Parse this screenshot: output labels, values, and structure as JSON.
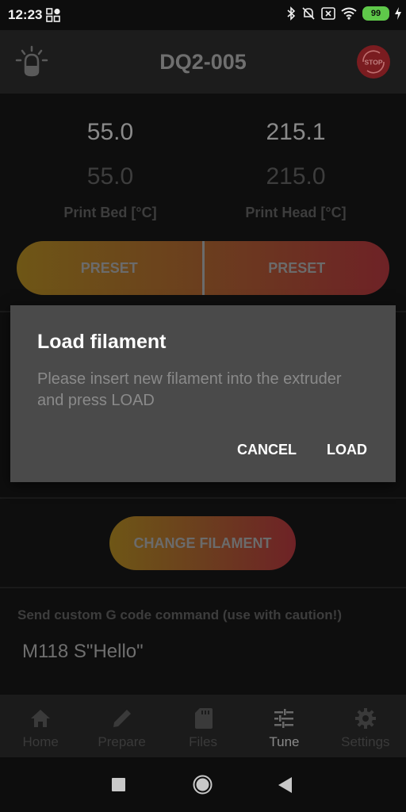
{
  "status_bar": {
    "time": "12:23",
    "battery_level": "99",
    "icons": [
      "bluetooth-icon",
      "notifications-off-icon",
      "sim-x-icon",
      "wifi-icon",
      "battery-icon",
      "charging-icon"
    ]
  },
  "header": {
    "title": "DQ2-005",
    "left_icon": "light-bulb-icon",
    "right_icon": "emergency-stop-icon",
    "stop_label": "STOP"
  },
  "temperatures": {
    "bed": {
      "actual": "55.0",
      "target": "55.0",
      "label": "Print Bed [°C]"
    },
    "head": {
      "actual": "215.1",
      "target": "215.0",
      "label": "Print Head [°C]"
    }
  },
  "presets": {
    "bed_label": "PRESET",
    "head_label": "PRESET"
  },
  "change_filament": {
    "label": "CHANGE FILAMENT"
  },
  "gcode": {
    "label": "Send custom G code command (use with caution!)",
    "value": "M118 S\"Hello\""
  },
  "dialog": {
    "title": "Load filament",
    "message": "Please insert new filament into the extruder and press LOAD",
    "cancel_label": "CANCEL",
    "confirm_label": "LOAD"
  },
  "bottom_nav": {
    "active": "Tune",
    "items": [
      {
        "label": "Home",
        "icon": "home-icon"
      },
      {
        "label": "Prepare",
        "icon": "pencil-icon"
      },
      {
        "label": "Files",
        "icon": "sd-card-icon"
      },
      {
        "label": "Tune",
        "icon": "sliders-icon"
      },
      {
        "label": "Settings",
        "icon": "gear-icon"
      }
    ]
  },
  "system_nav": {
    "items": [
      "recents-button",
      "home-button",
      "back-button"
    ]
  },
  "colors": {
    "background": "#0e0e0e",
    "header_bg": "#1c1c1c",
    "dialog_bg": "#4a4a4a",
    "gradient_start": "#6e5616",
    "gradient_end": "#6e2226",
    "stop_red": "#7a1c20",
    "battery_green": "#5fc84a"
  }
}
